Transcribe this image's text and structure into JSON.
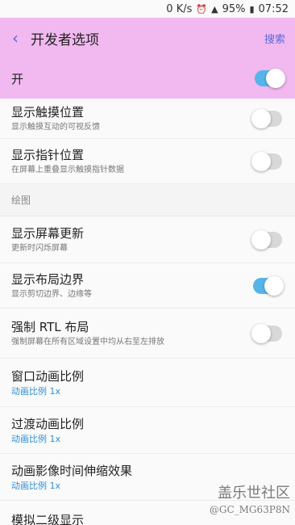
{
  "status_bar": {
    "speed": "0 K/s",
    "battery": "95%",
    "time": "07:52"
  },
  "app_bar": {
    "title": "开发者选项",
    "search_label": "搜索"
  },
  "master_switch": {
    "label": "开",
    "state": "on"
  },
  "settings": {
    "show_touches": {
      "title": "显示触摸位置",
      "subtitle": "显示触摸互动的可视反馈",
      "state": "off"
    },
    "pointer_location": {
      "title": "显示指针位置",
      "subtitle": "在屏幕上重叠显示触摸指针数据",
      "state": "off"
    },
    "section_drawing": "绘图",
    "show_screen_updates": {
      "title": "显示屏幕更新",
      "subtitle": "更新时闪烁屏幕",
      "state": "off"
    },
    "show_layout_bounds": {
      "title": "显示布局边界",
      "subtitle": "显示剪切边界、边缘等",
      "state": "on"
    },
    "force_rtl": {
      "title": "强制 RTL 布局",
      "subtitle": "强制屏幕在所有区域设置中均从右至左排放",
      "state": "off"
    },
    "window_anim": {
      "title": "窗口动画比例",
      "value": "动画比例 1x"
    },
    "transition_anim": {
      "title": "过渡动画比例",
      "value": "动画比例 1x"
    },
    "animator_duration": {
      "title": "动画影像时间伸缩效果",
      "value": "动画比例 1x"
    },
    "simulate_display": {
      "title": "模拟二级显示"
    }
  },
  "watermark": {
    "line1": "盖乐世社区",
    "line2": "@GC_MG63P8N"
  }
}
